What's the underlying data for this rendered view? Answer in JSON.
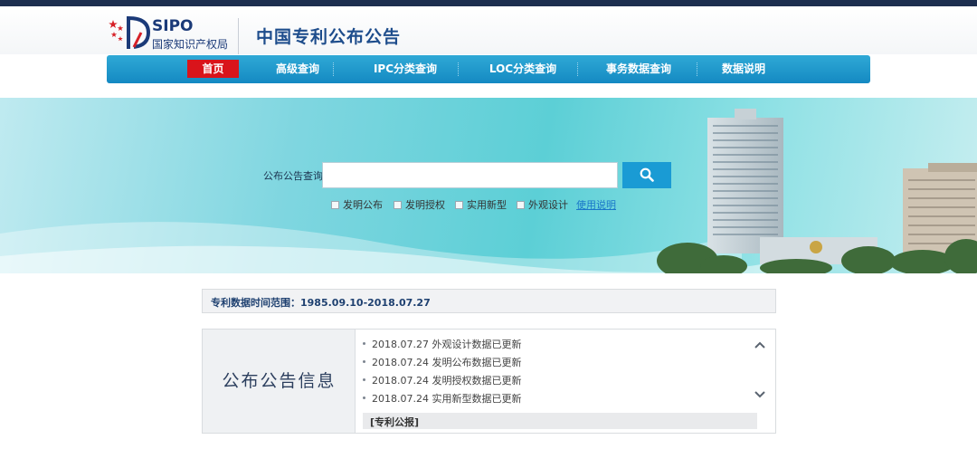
{
  "header": {
    "logo_text": "SIPO",
    "logo_subtext": "国家知识产权局",
    "site_title": "中国专利公布公告"
  },
  "nav": {
    "items": [
      {
        "label": "首页",
        "active": true
      },
      {
        "label": "高级查询",
        "active": false
      },
      {
        "label": "IPC分类查询",
        "active": false
      },
      {
        "label": "LOC分类查询",
        "active": false
      },
      {
        "label": "事务数据查询",
        "active": false
      },
      {
        "label": "数据说明",
        "active": false
      }
    ]
  },
  "search": {
    "label": "公布公告查询",
    "value": "",
    "placeholder": "",
    "button_icon": "search-icon",
    "options": [
      {
        "label": "发明公布",
        "checked": false
      },
      {
        "label": "发明授权",
        "checked": false
      },
      {
        "label": "实用新型",
        "checked": false
      },
      {
        "label": "外观设计",
        "checked": false
      }
    ],
    "help_link": "使用说明"
  },
  "data_range": {
    "text": "专利数据时间范围：1985.09.10-2018.07.27"
  },
  "announcements": {
    "title": "公布公告信息",
    "items": [
      "2018.07.27 外观设计数据已更新",
      "2018.07.24 发明公布数据已更新",
      "2018.07.24 发明授权数据已更新",
      "2018.07.24 实用新型数据已更新"
    ],
    "section_label": "[专利公报]",
    "scroll_up_icon": "chevron-up-icon",
    "scroll_down_icon": "chevron-down-icon"
  },
  "colors": {
    "nav_bg": "#1489c2",
    "nav_active": "#d9141b",
    "search_button": "#1a9bd4",
    "title_blue": "#1e4d8c"
  }
}
